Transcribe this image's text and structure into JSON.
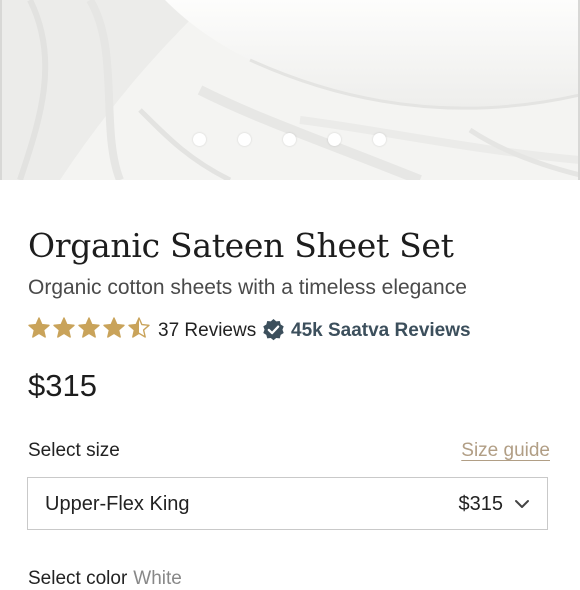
{
  "product": {
    "title": "Organic Sateen Sheet Set",
    "subtitle": "Organic cotton sheets with a timeless elegance",
    "rating": 4.5,
    "rating_max": 5,
    "reviews_label": "37 Reviews",
    "brand_reviews_label": "45k Saatva Reviews",
    "price": "$315"
  },
  "carousel": {
    "slide_count": 5,
    "active_index": 0
  },
  "size": {
    "label": "Select size",
    "guide_label": "Size guide",
    "selected": "Upper-Flex King",
    "selected_price": "$315"
  },
  "color": {
    "label": "Select color",
    "value": "White"
  },
  "colors": {
    "star": "#c9a35a",
    "brand": "#3c4f5c",
    "link": "#b19e85"
  }
}
